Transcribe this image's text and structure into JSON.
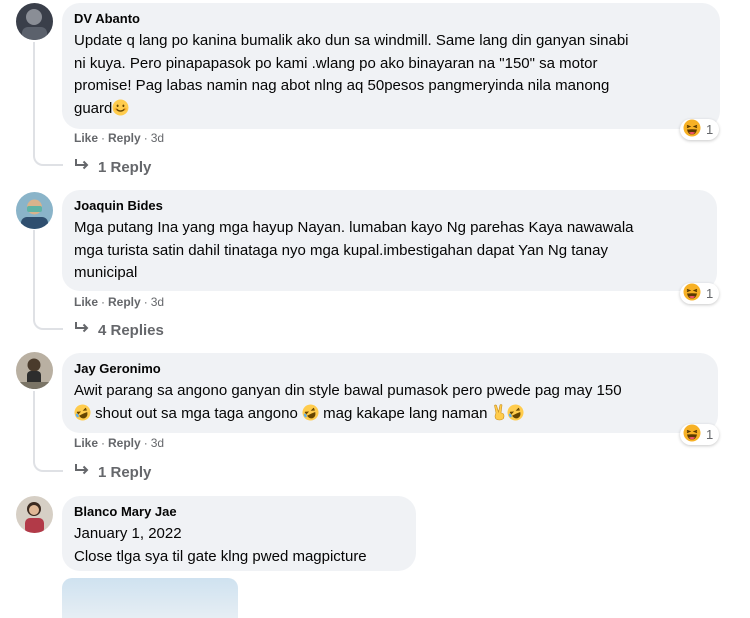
{
  "comments": [
    {
      "author": "DV Abanto",
      "lines": [
        "Update q lang po kanina bumalik ako dun sa windmill. Same lang din ganyan sinabi",
        "ni kuya. Pero pinapapasok po kami .wlang po ako binayaran na \"150\" sa motor",
        "promise! Pag labas namin nag abot nlng aq 50pesos pangmeryinda nila manong",
        "guard"
      ],
      "like": "Like",
      "reply": "Reply",
      "time": "3d",
      "reaction_count": "1",
      "replies": "1 Reply"
    },
    {
      "author": "Joaquin Bides",
      "lines": [
        "Mga putang Ina yang mga hayup Nayan. lumaban kayo Ng parehas Kaya nawawala",
        "mga turista satin dahil tinataga nyo mga kupal.imbestigahan dapat Yan Ng tanay",
        "municipal"
      ],
      "like": "Like",
      "reply": "Reply",
      "time": "3d",
      "reaction_count": "1",
      "replies": "4 Replies"
    },
    {
      "author": "Jay Geronimo",
      "lines": [
        "Awit parang sa angono ganyan din style bawal pumasok pero pwede pag may 150",
        "shout out sa mga taga angono",
        "mag kakape lang naman"
      ],
      "like": "Like",
      "reply": "Reply",
      "time": "3d",
      "reaction_count": "1",
      "replies": "1 Reply"
    },
    {
      "author": "Blanco Mary Jae",
      "lines": [
        "January 1, 2022",
        "Close tlga sya til gate klng pwed magpicture"
      ]
    }
  ],
  "icons": {
    "reaction": "laughing-emoji-icon",
    "reply_arrow": "reply-arrow-icon",
    "smile": "smiling-emoji-icon",
    "rofl": "rofl-emoji-icon",
    "peace": "victory-hand-icon"
  },
  "colors": {
    "bubble": "#f0f2f5",
    "muted": "#65676b",
    "text": "#050505"
  }
}
